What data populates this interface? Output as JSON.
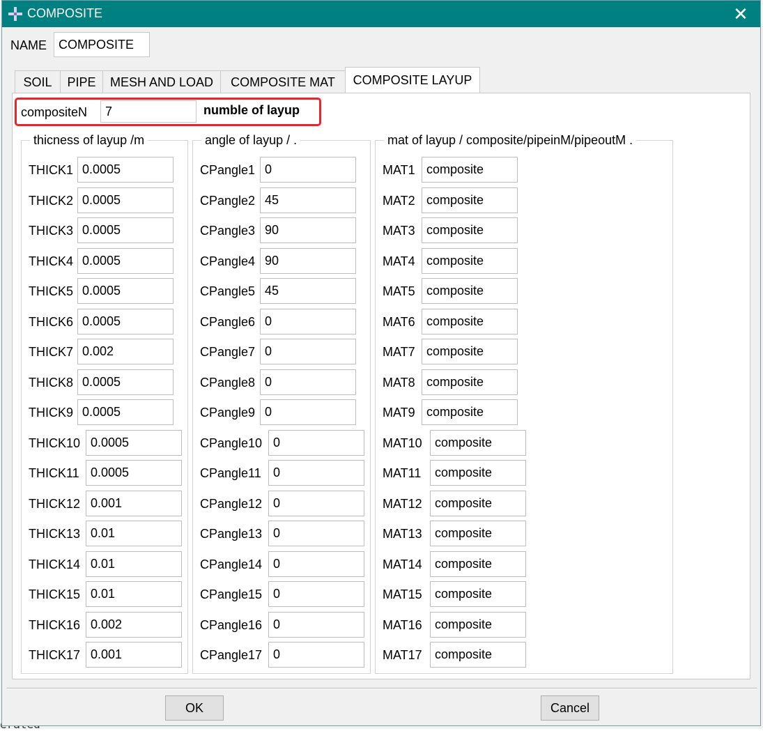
{
  "window": {
    "title": "COMPOSITE",
    "close_label": "✕"
  },
  "name": {
    "label": "NAME",
    "value": "COMPOSITE"
  },
  "tabs": [
    {
      "label": "SOIL",
      "active": false
    },
    {
      "label": "PIPE",
      "active": false
    },
    {
      "label": "MESH AND LOAD",
      "active": false
    },
    {
      "label": "COMPOSITE MAT",
      "active": false
    },
    {
      "label": "COMPOSITE LAYUP",
      "active": true
    }
  ],
  "composite_n": {
    "label": "compositeN",
    "value": "7",
    "description": "numble of layup"
  },
  "groups": {
    "thickness": {
      "title": "thicness of layup /m",
      "rows": [
        {
          "label": "THICK1",
          "value": "0.0005"
        },
        {
          "label": "THICK2",
          "value": "0.0005"
        },
        {
          "label": "THICK3",
          "value": "0.0005"
        },
        {
          "label": "THICK4",
          "value": "0.0005"
        },
        {
          "label": "THICK5",
          "value": "0.0005"
        },
        {
          "label": "THICK6",
          "value": "0.0005"
        },
        {
          "label": "THICK7",
          "value": "0.002"
        },
        {
          "label": "THICK8",
          "value": "0.0005"
        },
        {
          "label": "THICK9",
          "value": "0.0005"
        },
        {
          "label": "THICK10",
          "value": "0.0005"
        },
        {
          "label": "THICK11",
          "value": "0.0005"
        },
        {
          "label": "THICK12",
          "value": "0.001"
        },
        {
          "label": "THICK13",
          "value": "0.01"
        },
        {
          "label": "THICK14",
          "value": "0.01"
        },
        {
          "label": "THICK15",
          "value": "0.01"
        },
        {
          "label": "THICK16",
          "value": "0.002"
        },
        {
          "label": "THICK17",
          "value": "0.001"
        }
      ]
    },
    "angle": {
      "title": "angle of layup / .",
      "rows": [
        {
          "label": "CPangle1",
          "value": "0"
        },
        {
          "label": "CPangle2",
          "value": "45"
        },
        {
          "label": "CPangle3",
          "value": "90"
        },
        {
          "label": "CPangle4",
          "value": "90"
        },
        {
          "label": "CPangle5",
          "value": "45"
        },
        {
          "label": "CPangle6",
          "value": "0"
        },
        {
          "label": "CPangle7",
          "value": "0"
        },
        {
          "label": "CPangle8",
          "value": "0"
        },
        {
          "label": "CPangle9",
          "value": "0"
        },
        {
          "label": "CPangle10",
          "value": "0"
        },
        {
          "label": "CPangle11",
          "value": "0"
        },
        {
          "label": "CPangle12",
          "value": "0"
        },
        {
          "label": "CPangle13",
          "value": "0"
        },
        {
          "label": "CPangle14",
          "value": "0"
        },
        {
          "label": "CPangle15",
          "value": "0"
        },
        {
          "label": "CPangle16",
          "value": "0"
        },
        {
          "label": "CPangle17",
          "value": "0"
        }
      ]
    },
    "material": {
      "title": "mat of layup / composite/pipeinM/pipeoutM .",
      "rows": [
        {
          "label": "MAT1",
          "value": "composite"
        },
        {
          "label": "MAT2",
          "value": "composite"
        },
        {
          "label": "MAT3",
          "value": "composite"
        },
        {
          "label": "MAT4",
          "value": "composite"
        },
        {
          "label": "MAT5",
          "value": "composite"
        },
        {
          "label": "MAT6",
          "value": "composite"
        },
        {
          "label": "MAT7",
          "value": "composite"
        },
        {
          "label": "MAT8",
          "value": "composite"
        },
        {
          "label": "MAT9",
          "value": "composite"
        },
        {
          "label": "MAT10",
          "value": "composite"
        },
        {
          "label": "MAT11",
          "value": "composite"
        },
        {
          "label": "MAT12",
          "value": "composite"
        },
        {
          "label": "MAT13",
          "value": "composite"
        },
        {
          "label": "MAT14",
          "value": "composite"
        },
        {
          "label": "MAT15",
          "value": "composite"
        },
        {
          "label": "MAT16",
          "value": "composite"
        },
        {
          "label": "MAT17",
          "value": "composite"
        }
      ]
    }
  },
  "buttons": {
    "ok": "OK",
    "cancel": "Cancel"
  },
  "background_text": "erated",
  "colors": {
    "titlebar": "#008080",
    "highlight": "#e8262a"
  },
  "icons": {
    "app": "abaqus-cross-icon",
    "close": "close-icon"
  }
}
